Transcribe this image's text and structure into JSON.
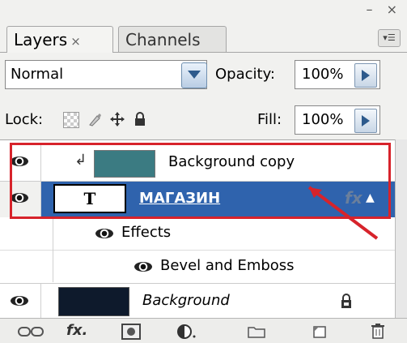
{
  "window": {
    "controls": "– ×"
  },
  "tabs": [
    {
      "label": "Layers",
      "close": "×"
    },
    {
      "label": "Channels"
    }
  ],
  "blend_mode": {
    "value": "Normal"
  },
  "opacity": {
    "label": "Opacity:",
    "value": "100%"
  },
  "lock": {
    "label": "Lock:"
  },
  "fill": {
    "label": "Fill:",
    "value": "100%"
  },
  "layers": [
    {
      "name": "Background copy",
      "thumb_color": "#3b7b82"
    },
    {
      "name": "МАГАЗИН",
      "thumb_text": "T"
    },
    {
      "name": "Effects"
    },
    {
      "name": "Bevel and Emboss"
    },
    {
      "name": "Background",
      "thumb_color": "#0e1a2c"
    }
  ],
  "colors": {
    "selected": "#2f63ad",
    "highlight": "#d7232b"
  }
}
